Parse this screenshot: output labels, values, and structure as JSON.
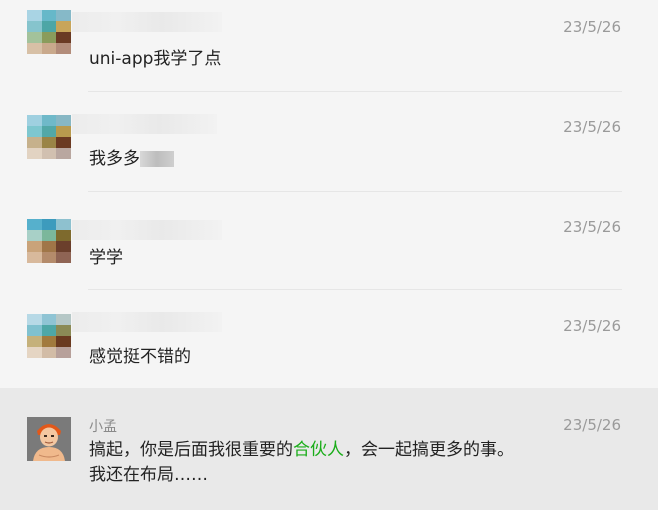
{
  "messages": [
    {
      "time": "23/5/26",
      "text": "uni-app我学了点"
    },
    {
      "time": "23/5/26",
      "text": "我多多"
    },
    {
      "time": "23/5/26",
      "text": "学学"
    },
    {
      "time": "23/5/26",
      "text": "感觉挺不错的"
    },
    {
      "name": "小孟",
      "time": "23/5/26",
      "text_part1": "搞起，你是后面我很重要的",
      "highlight": "合伙人",
      "text_part2": "，会一起搞更多的事。我还在布局……",
      "highlight_color": "#1aad19"
    }
  ]
}
